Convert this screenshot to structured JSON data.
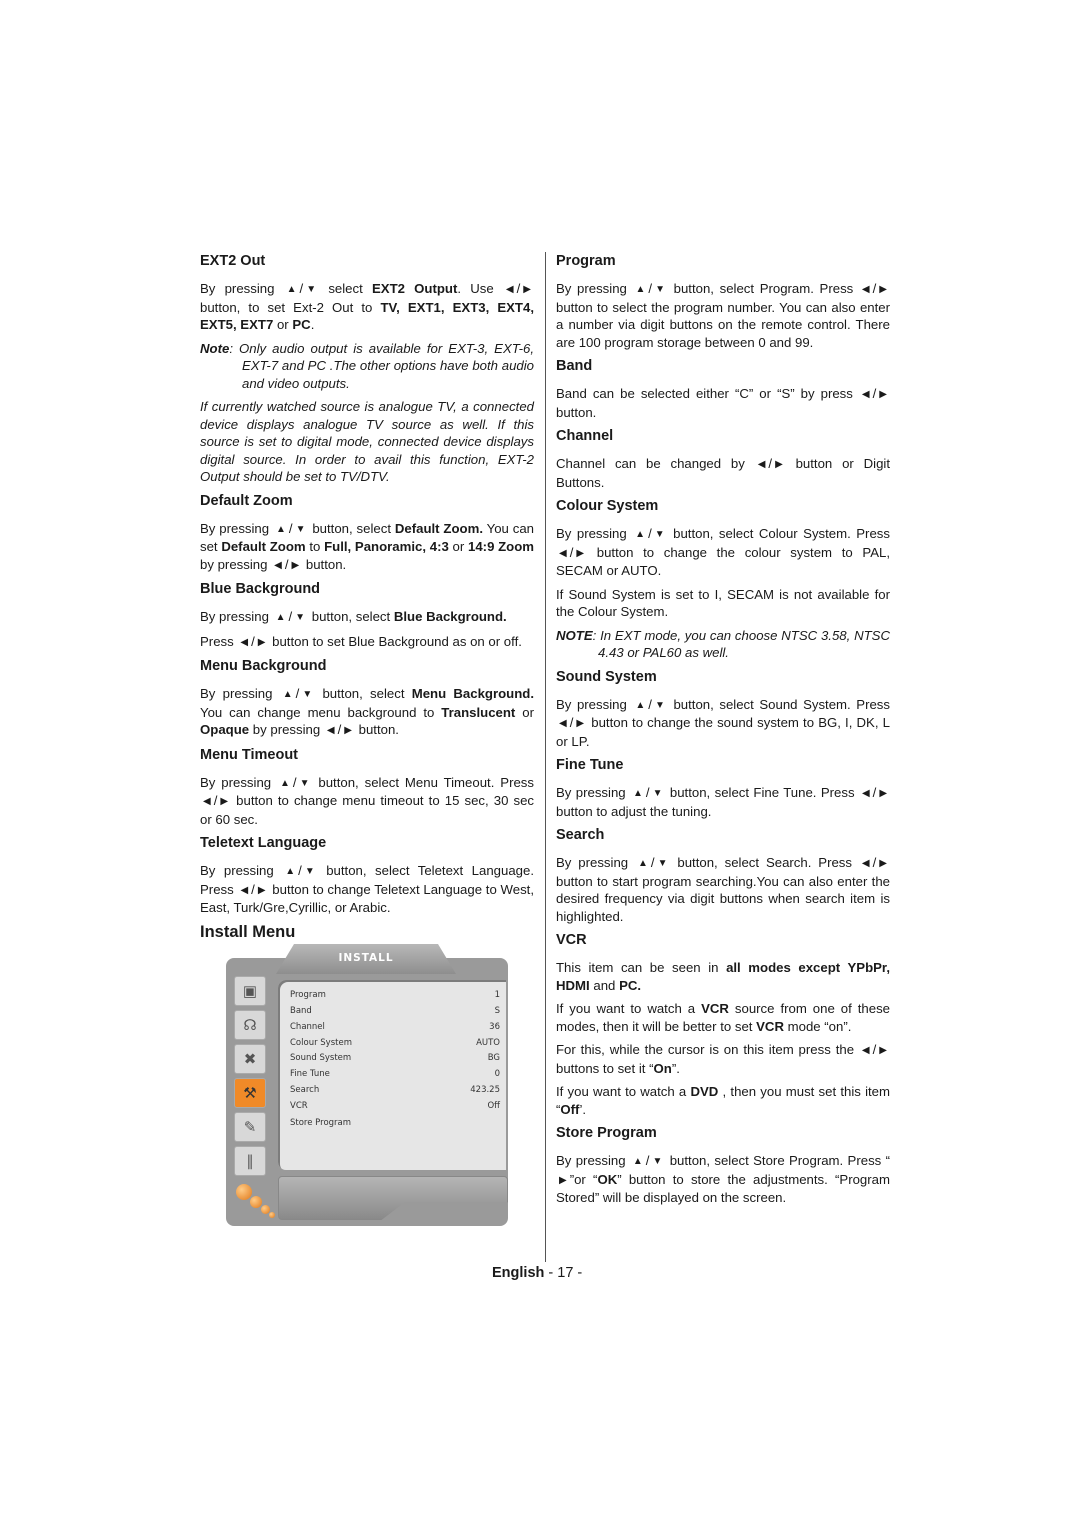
{
  "left_column": {
    "ext2_out": {
      "heading": "EXT2 Out",
      "p1_a": "By pressing",
      "p1_b": "select",
      "p1_bold1": "EXT2 Output",
      "p1_c": ". Use",
      "p1_d": "button, to set Ext-2 Out to",
      "p1_bold2": "TV, EXT1, EXT3, EXT4, EXT5, EXT7",
      "p1_e": "or",
      "p1_bold3": "PC",
      "p1_f": ".",
      "note_label": "Note",
      "note_text": ": Only audio output is available for EXT-3, EXT-6, EXT-7 and PC .The other options have both audio and video outputs.",
      "italic_para": "If currently watched source is analogue TV, a connected device displays analogue TV source as well. If this source is set to digital mode, connected device displays digital source. In order to avail this function, EXT-2 Output should be set to TV/DTV."
    },
    "default_zoom": {
      "heading": "Default Zoom",
      "a": "By pressing",
      "b": "button, select",
      "bold1": "Default Zoom.",
      "c": "You can set",
      "bold2": "Default Zoom",
      "d": "to",
      "bold3": "Full, Panoramic, 4:3",
      "e": "or",
      "bold4": "14:9 Zoom",
      "f": "by pressing",
      "g": "button."
    },
    "blue_background": {
      "heading": "Blue Background",
      "a": "By pressing",
      "b": "button, select",
      "bold1": "Blue Background.",
      "c": "Press",
      "d": "button  to set Blue Background as on or off."
    },
    "menu_background": {
      "heading": "Menu Background",
      "a": "By pressing",
      "b": "button, select",
      "bold1": "Menu Background.",
      "c": "You can change menu background to",
      "bold2": "Translucent",
      "d": "or",
      "bold3": "Opaque",
      "e": "by pressing",
      "f": "button."
    },
    "menu_timeout": {
      "heading": "Menu Timeout",
      "a": "By pressing",
      "b": "button, select Menu Timeout.",
      "c": "Press",
      "d": "button to change menu timeout to 15 sec, 30 sec or 60 sec."
    },
    "teletext_language": {
      "heading": "Teletext Language",
      "a": "By pressing",
      "b": "button, select Teletext Language.",
      "c": "Press",
      "d": "button to change Teletext Language to West, East, Turk/Gre,Cyrillic,  or Arabic."
    },
    "install_menu_heading": "Install Menu"
  },
  "install_menu": {
    "title": "INSTALL",
    "rows": [
      {
        "label": "Program",
        "value": "1"
      },
      {
        "label": "Band",
        "value": "S"
      },
      {
        "label": "Channel",
        "value": "36"
      },
      {
        "label": "Colour System",
        "value": "AUTO"
      },
      {
        "label": "Sound System",
        "value": "BG"
      },
      {
        "label": "Fine Tune",
        "value": "0"
      },
      {
        "label": "Search",
        "value": "423.25"
      },
      {
        "label": "VCR",
        "value": "Off"
      },
      {
        "label": "Store Program",
        "value": ""
      }
    ],
    "side_icons": [
      "monitor-icon",
      "headphones-icon",
      "tools-icon",
      "wrench-icon",
      "notepad-icon",
      "pliers-icon"
    ],
    "active_icon": "wrench-icon",
    "accent_color": "#f08a28"
  },
  "right_column": {
    "program": {
      "heading": "Program",
      "a": "By pressing",
      "b": "button, select Program. Press",
      "c": "button to select the program number. You can also enter a number via digit buttons on the remote control. There are 100 program storage between 0 and 99."
    },
    "band": {
      "heading": "Band",
      "a": "Band can be selected either “C” or “S” by press",
      "b": "button."
    },
    "channel": {
      "heading": "Channel",
      "a": "Channel can be changed by",
      "b": "button or Digit Buttons."
    },
    "colour_system": {
      "heading": "Colour System",
      "a": "By pressing",
      "b": "button, select Colour System.",
      "c": "Press",
      "d": "button to change the colour system to PAL, SECAM or AUTO.",
      "p2": "If Sound  System is set to I, SECAM is not available for the Colour System.",
      "note_label": "NOTE",
      "note_text": ": In EXT mode, you can choose NTSC 3.58, NTSC 4.43 or PAL60 as well."
    },
    "sound_system": {
      "heading": "Sound System",
      "a": "By pressing",
      "b": "button, select Sound System.",
      "c": "Press",
      "d": "button to change the sound system to BG, I,  DK, L or LP."
    },
    "fine_tune": {
      "heading": "Fine Tune",
      "a": "By pressing",
      "b": "button, select Fine Tune. Press",
      "c": "button to adjust the tuning."
    },
    "search": {
      "heading": "Search",
      "a": "By pressing",
      "b": "button, select Search.  Press",
      "c": "button to start program searching.You can also enter the desired frequency via digit buttons when search item is highlighted."
    },
    "vcr": {
      "heading": "VCR",
      "p1_a": "This item can be seen in",
      "p1_bold1": "all modes except  YPbPr, HDMI",
      "p1_b": "and",
      "p1_bold2": "PC.",
      "p2_a": "If you want to watch a",
      "p2_bold1": "VCR",
      "p2_b": "source from one of these modes, then  it will be better to set",
      "p2_bold2": "VCR",
      "p2_c": "mode “on”.",
      "p3_a": "For this, while the cursor is on this item press the",
      "p3_b": "buttons to set it “",
      "p3_bold": "On",
      "p3_c": "”.",
      "p4_a": "If you want to watch a",
      "p4_bold1": "DVD",
      "p4_b": ", then you must set this item “",
      "p4_bold2": "Off",
      "p4_c": "’."
    },
    "store_program": {
      "heading": "Store Program",
      "a": "By pressing",
      "b": "button, select Store Program.",
      "c": "Press “",
      "d": "”or “",
      "bold1": "OK",
      "e": "” button to store the adjustments. “Program Stored” will be displayed on the screen."
    }
  },
  "footer": {
    "language": "English",
    "page": "- 17 -"
  },
  "icons": {
    "up": "▲",
    "down": "▼",
    "left": "◀",
    "right": "▶",
    "slash": "/"
  }
}
